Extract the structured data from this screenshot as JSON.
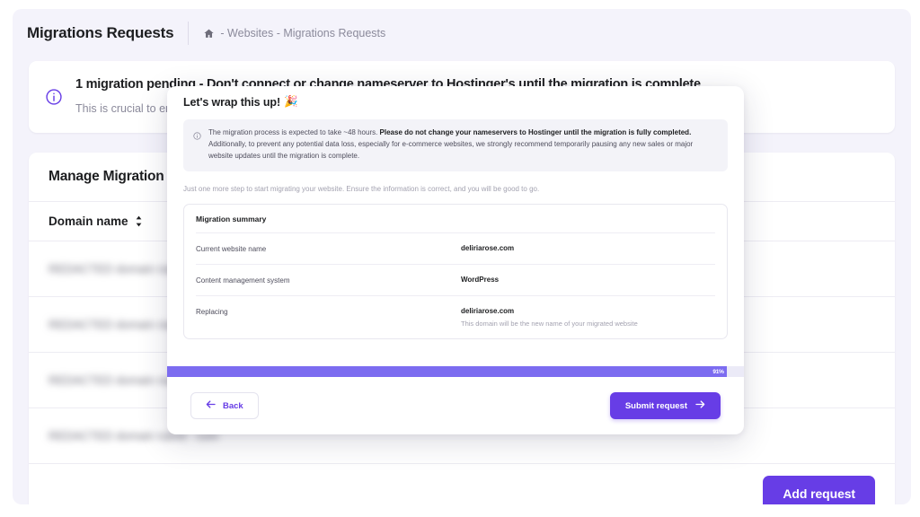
{
  "header": {
    "title": "Migrations Requests",
    "breadcrumb": "- Websites - Migrations Requests",
    "home_icon": "home-icon"
  },
  "alert": {
    "icon": "info-circle-icon",
    "title": "1 migration pending - Don't connect or change nameserver to Hostinger's until the migration is complete",
    "text": "This is crucial to ensure no data is lost. Do not make any changes to your nameservers until the migration is complete."
  },
  "table": {
    "heading": "Manage Migration Requests",
    "column_header": "Domain name",
    "sort_icon": "sort-updown-icon",
    "rows": [
      {
        "domain": "REDACTED domain name . com"
      },
      {
        "domain": "REDACTED domain name . com"
      },
      {
        "domain": "REDACTED domain name . com"
      },
      {
        "domain": "REDACTED domain name . com"
      }
    ],
    "add_request_label": "Add request"
  },
  "modal": {
    "title": "Let's wrap this up!",
    "title_emoji": "🎉",
    "notice": {
      "icon": "info-circle-icon",
      "line1_plain": "The migration process is expected to take ~48 hours. ",
      "line1_bold": "Please do not change your nameservers to Hostinger until the migration is fully completed.",
      "line2": "Additionally, to prevent any potential data loss, especially for e-commerce websites, we strongly recommend temporarily pausing any new sales or major website updates until the migration is complete."
    },
    "substep": "Just one more step to start migrating your website. Ensure the information is correct, and you will be good to go.",
    "summary": {
      "title": "Migration summary",
      "rows": [
        {
          "label": "Current website name",
          "value": "deliriarose.com",
          "hint": ""
        },
        {
          "label": "Content management system",
          "value": "WordPress",
          "hint": ""
        },
        {
          "label": "Replacing",
          "value": "deliriarose.com",
          "hint": "This domain will be the new name of your migrated website"
        }
      ]
    },
    "progress": {
      "label": "91%",
      "percent": 97
    },
    "back_label": "Back",
    "back_icon": "arrow-left-icon",
    "submit_label": "Submit request",
    "submit_icon": "arrow-right-icon"
  },
  "colors": {
    "accent": "#673de6",
    "progress_fill": "#7c6cf0",
    "page_bg": "#f4f3fb"
  }
}
